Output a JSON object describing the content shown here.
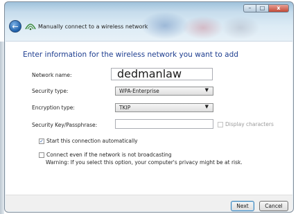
{
  "window": {
    "title": "Manually connect to a wireless network",
    "controls": {
      "minimize": "–",
      "maximize": "□",
      "close": "x"
    }
  },
  "page": {
    "heading": "Enter information for the wireless network you want to add"
  },
  "form": {
    "network_name": {
      "label": "Network name:",
      "value": "dedmanlaw"
    },
    "security_type": {
      "label": "Security type:",
      "value": "WPA-Enterprise"
    },
    "encryption_type": {
      "label": "Encryption type:",
      "value": "TKIP"
    },
    "security_key": {
      "label": "Security Key/Passphrase:",
      "value": ""
    },
    "display_characters": {
      "label": "Display characters",
      "checked": false
    },
    "start_auto": {
      "label": "Start this connection automatically",
      "checked": true
    },
    "connect_even": {
      "label": "Connect even if the network is not broadcasting",
      "checked": false
    },
    "warning": "Warning: If you select this option, your computer's privacy might be at risk."
  },
  "buttons": {
    "next": "Next",
    "cancel": "Cancel"
  },
  "icons": {
    "back": "back-arrow-icon",
    "network": "wireless-network-icon",
    "dropdown": "chevron-down-icon"
  }
}
